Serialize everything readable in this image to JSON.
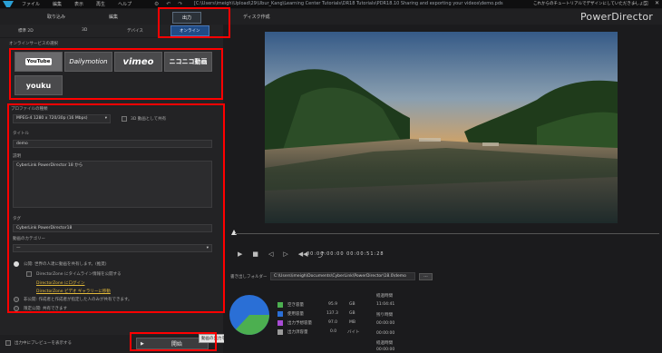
{
  "titlebar": {
    "menu": [
      "ファイル",
      "編集",
      "表示",
      "再生",
      "ヘルプ"
    ],
    "path": "[C:\\Users\\imeigh\\Upload\\29\\Ubur_Kang\\Learning Center Tutorials\\DR18 Tutorials\\PDR18.10 Sharing and exporting your videos\\demo.pds",
    "tip": "これからのチュートリアルでデザインにしていただきましょう",
    "window_controls": [
      "–",
      "□",
      "✕"
    ]
  },
  "modebar": {
    "tabs": [
      "取り込み",
      "編集",
      "出力",
      "ディスク作成"
    ],
    "active": "出力",
    "brand": "PowerDirector"
  },
  "subtabs": {
    "items": [
      "標準 2D",
      "3D",
      "デバイス",
      "オンライン"
    ],
    "active": "オンライン"
  },
  "sites": {
    "section_label": "オンラインサービスの選択",
    "items": [
      "YouTube",
      "Dailymotion",
      "vimeo",
      "ニコニコ動画",
      "youku"
    ]
  },
  "form": {
    "profile_label": "プロファイルの種類",
    "profile_value": "MPEG-4 1280 x 720/30p (16 Mbps)",
    "upload_3d_label": "3D 動画として共有",
    "title_label": "タイトル",
    "title_value": "demo",
    "desc_label": "説明",
    "desc_value": "CyberLink PowerDirector 18 から",
    "tags_label": "タグ",
    "tags_value": "CyberLink PowerDirector18",
    "category_label": "動画のカテゴリー",
    "category_value": "—",
    "public_label": "公開: 世界の人達に動画を共有します。(推奨)",
    "directorzone_label": "DirectorZone にタイムライン情報を公開する",
    "link1": "DirectorZone にログイン",
    "link2": "DirectorZone ビデオ ギャラリーに移動",
    "private_label": "非公開: 作成者と作成者が指定した人のみが共有できます。",
    "unlisted_label": "限定公開: 共有できます"
  },
  "bottom_left": {
    "preview_label": "出力中にプレビューを表示する",
    "start_label": "開始",
    "tooltip": "動画の出力を開始"
  },
  "player": {
    "controls": [
      "▶",
      "■",
      "◁",
      "▷",
      "◀◀",
      "⤴"
    ],
    "timecode": "00:00:00:00  00:00:51:28"
  },
  "output": {
    "folder_label": "書き出しフォルダー",
    "folder_path": "C:\\Users\\imeigh\\Documents\\CyberLink\\PowerDirector\\18.0\\demo",
    "browse_label": "..."
  },
  "disk": {
    "items": [
      {
        "label": "空き容量",
        "value": "95.9",
        "unit": "GB",
        "color": "#4caf50"
      },
      {
        "label": "使用容量",
        "value": "137.3",
        "unit": "GB",
        "color": "#2a6fd6"
      },
      {
        "label": "出力予想容量",
        "value": "97.0",
        "unit": "MB",
        "color": "#a94cd6"
      },
      {
        "label": "出力済容量",
        "value": "0.0",
        "unit": "バイト",
        "color": "#9a9a9a"
      }
    ],
    "chart_fractions": {
      "free": 0.41,
      "used": 0.59
    }
  },
  "times": {
    "items": [
      {
        "label": "経過時間",
        "value": "11:04:41"
      },
      {
        "label": "残り時間",
        "value": "00:00:00"
      },
      {
        "label": "",
        "value": "00:00:00"
      },
      {
        "label": "経過時間",
        "value": "00:00:00"
      }
    ]
  },
  "colors": {
    "accent_red": "#ff0000",
    "active_tab": "#1f4b86",
    "link": "#e2b93b"
  }
}
